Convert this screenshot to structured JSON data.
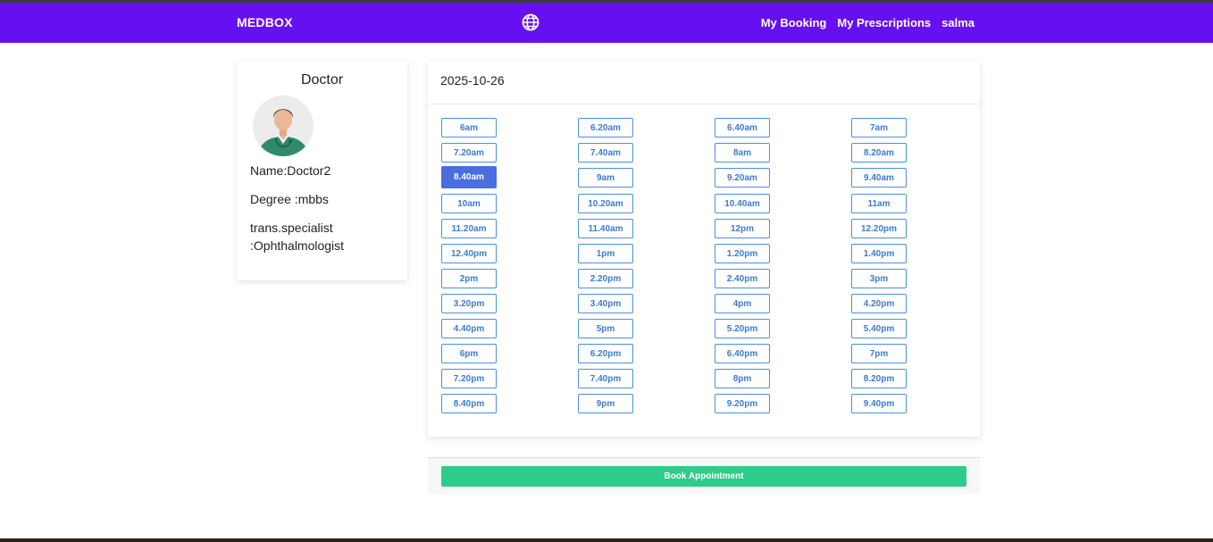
{
  "navbar": {
    "brand": "MEDBOX",
    "links": [
      "My Booking",
      "My Prescriptions",
      "salma"
    ],
    "accent_color": "#6610f2",
    "globe_icon": "globe-icon"
  },
  "doctor": {
    "title": "Doctor",
    "name_line": "Name:Doctor2",
    "degree_line": "Degree :mbbs",
    "specialist_line1": "trans.specialist",
    "specialist_line2": ":Ophthalmologist",
    "avatar_icon": "doctor-avatar-icon"
  },
  "schedule": {
    "date": "2025-10-26",
    "selected": "8.40am",
    "slots": [
      "6am",
      "6.20am",
      "6.40am",
      "7am",
      "7.20am",
      "7.40am",
      "8am",
      "8.20am",
      "8.40am",
      "9am",
      "9.20am",
      "9.40am",
      "10am",
      "10.20am",
      "10.40am",
      "11am",
      "11.20am",
      "11.40am",
      "12pm",
      "12.20pm",
      "12.40pm",
      "1pm",
      "1.20pm",
      "1.40pm",
      "2pm",
      "2.20pm",
      "2.40pm",
      "3pm",
      "3.20pm",
      "3.40pm",
      "4pm",
      "4.20pm",
      "4.40pm",
      "5pm",
      "5.20pm",
      "5.40pm",
      "6pm",
      "6.20pm",
      "6.40pm",
      "7pm",
      "7.20pm",
      "7.40pm",
      "8pm",
      "8.20pm",
      "8.40pm",
      "9pm",
      "9.20pm",
      "9.40pm"
    ]
  },
  "book": {
    "label": "Book Appointment",
    "color": "#2ecc8a"
  }
}
